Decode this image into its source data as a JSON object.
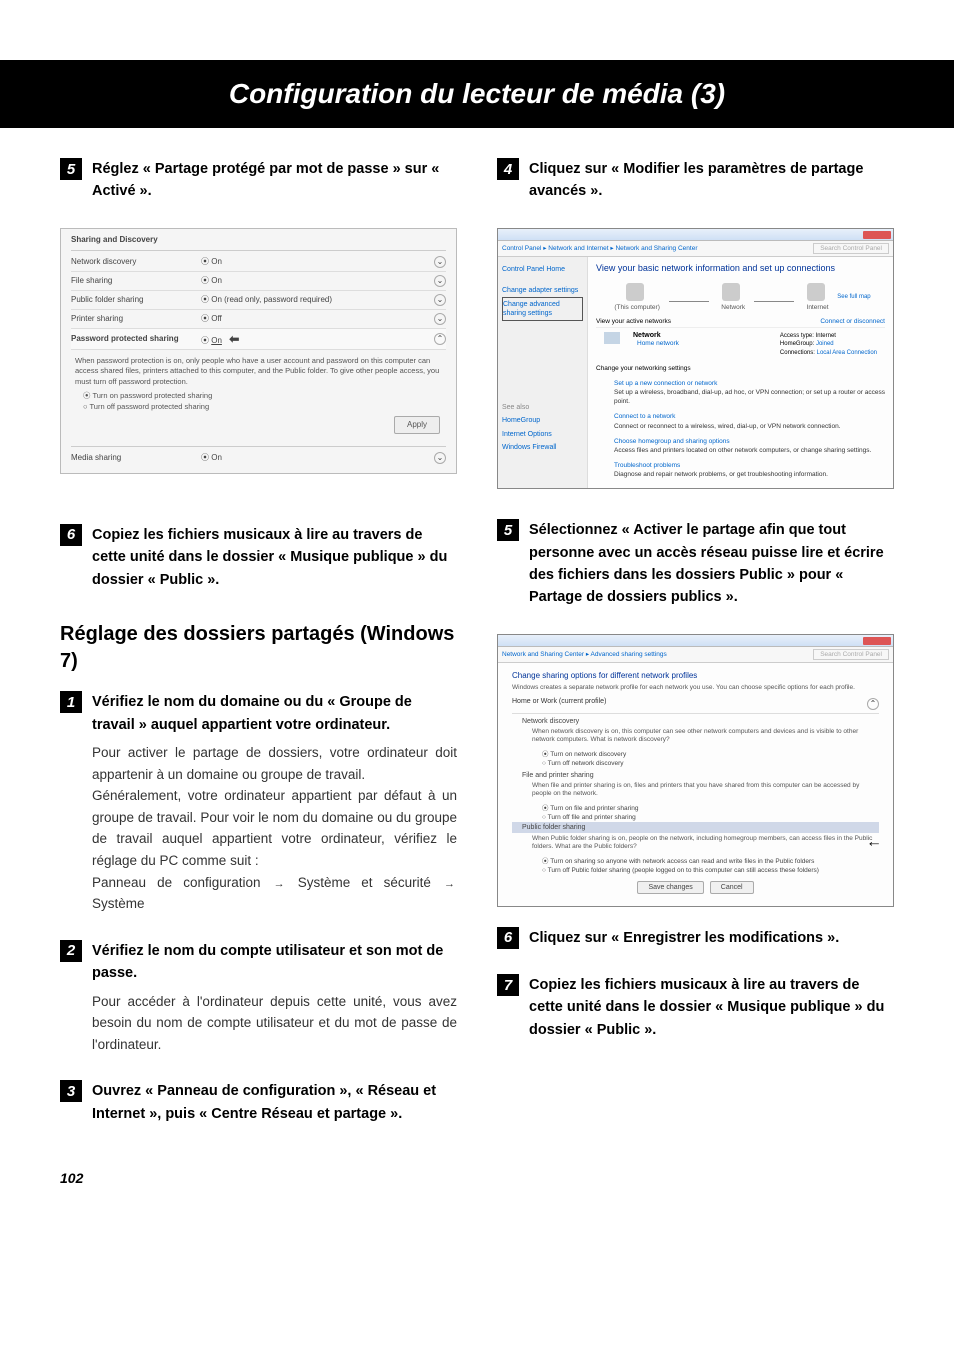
{
  "page_header": "Configuration du lecteur de média (3)",
  "page_number": "102",
  "left": {
    "step5_title": "Réglez « Partage protégé par mot de passe » sur « Activé ».",
    "screenshot1": {
      "panel_title": "Sharing and Discovery",
      "rows": {
        "network_discovery_label": "Network discovery",
        "network_discovery_value": "On",
        "file_sharing_label": "File sharing",
        "file_sharing_value": "On",
        "public_folder_label": "Public folder sharing",
        "public_folder_value": "On (read only, password required)",
        "printer_sharing_label": "Printer sharing",
        "printer_sharing_value": "Off",
        "password_label": "Password protected sharing",
        "password_value": "On",
        "media_sharing_label": "Media sharing",
        "media_sharing_value": "On"
      },
      "explain_text": "When password protection is on, only people who have a user account and password on this computer can access shared files, printers attached to this computer, and the Public folder. To give other people access, you must turn off password protection.",
      "radio1": "Turn on password protected sharing",
      "radio2": "Turn off password protected sharing",
      "apply_btn": "Apply"
    },
    "step6_title": "Copiez les fichiers musicaux à lire au travers de cette unité dans le dossier « Musique publique » du dossier « Public ».",
    "subheading": "Réglage des dossiers partagés (Windows 7)",
    "w7_step1_title": "Vérifiez le nom du domaine ou du « Groupe de travail » auquel appartient votre ordinateur.",
    "w7_step1_body1": "Pour activer le partage de dossiers, votre ordinateur doit appartenir à un domaine ou groupe de travail.",
    "w7_step1_body2a": "Généralement, votre ordinateur appartient par défaut à un groupe de travail. Pour voir le nom du domaine ou du groupe de travail auquel appartient votre ordinateur, vérifiez le réglage du PC comme suit :",
    "w7_step1_body2b": "Panneau de configuration",
    "w7_step1_body2c": "Système et sécurité",
    "w7_step1_body2d": "Système",
    "w7_step2_title": "Vérifiez le nom du compte utilisateur et son mot de passe.",
    "w7_step2_body": "Pour accéder à l'ordinateur depuis cette unité, vous avez besoin du nom de compte utilisateur et du mot de passe de l'ordinateur.",
    "w7_step3_title": "Ouvrez « Panneau de configuration », « Réseau et Internet », puis « Centre Réseau et partage »."
  },
  "right": {
    "step4_title": "Cliquez sur « Modifier les paramètres de partage avancés ».",
    "screenshot2": {
      "breadcrumb": "Control Panel ▸ Network and Internet ▸ Network and Sharing Center",
      "search_placeholder": "Search Control Panel",
      "sidebar": {
        "home": "Control Panel Home",
        "adapter": "Change adapter settings",
        "advanced": "Change advanced sharing settings",
        "seealso": "See also",
        "homegroup": "HomeGroup",
        "inet_options": "Internet Options",
        "firewall": "Windows Firewall"
      },
      "main_title": "View your basic network information and set up connections",
      "see_full_map": "See full map",
      "this_computer": "(This computer)",
      "network_label": "Network",
      "internet_label": "Internet",
      "view_active": "View your active networks",
      "connect_disconnect": "Connect or disconnect",
      "network_name": "Network",
      "home_network": "Home network",
      "access_type_label": "Access type:",
      "access_type_value": "Internet",
      "homegroup_label": "HomeGroup:",
      "homegroup_value": "Joined",
      "connections_label": "Connections:",
      "connections_value": "Local Area Connection",
      "change_networking": "Change your networking settings",
      "opt1_title": "Set up a new connection or network",
      "opt1_desc": "Set up a wireless, broadband, dial-up, ad hoc, or VPN connection; or set up a router or access point.",
      "opt2_title": "Connect to a network",
      "opt2_desc": "Connect or reconnect to a wireless, wired, dial-up, or VPN network connection.",
      "opt3_title": "Choose homegroup and sharing options",
      "opt3_desc": "Access files and printers located on other network computers, or change sharing settings.",
      "opt4_title": "Troubleshoot problems",
      "opt4_desc": "Diagnose and repair network problems, or get troubleshooting information."
    },
    "step5_title": "Sélectionnez « Activer le partage afin que tout personne avec un accès réseau puisse lire et écrire des fichiers dans les dossiers Public » pour « Partage de dossiers publics ».",
    "screenshot3": {
      "breadcrumb": "Network and Sharing Center ▸ Advanced sharing settings",
      "search_placeholder": "Search Control Panel",
      "title": "Change sharing options for different network profiles",
      "subtitle": "Windows creates a separate network profile for each network you use. You can choose specific options for each profile.",
      "profile": "Home or Work (current profile)",
      "nd_label": "Network discovery",
      "nd_desc": "When network discovery is on, this computer can see other network computers and devices and is visible to other network computers. What is network discovery?",
      "nd_on": "Turn on network discovery",
      "nd_off": "Turn off network discovery",
      "fp_label": "File and printer sharing",
      "fp_desc": "When file and printer sharing is on, files and printers that you have shared from this computer can be accessed by people on the network.",
      "fp_on": "Turn on file and printer sharing",
      "fp_off": "Turn off file and printer sharing",
      "pf_label": "Public folder sharing",
      "pf_desc": "When Public folder sharing is on, people on the network, including homegroup members, can access files in the Public folders. What are the Public folders?",
      "pf_on": "Turn on sharing so anyone with network access can read and write files in the Public folders",
      "pf_off": "Turn off Public folder sharing (people logged on to this computer can still access these folders)",
      "save_btn": "Save changes",
      "cancel_btn": "Cancel"
    },
    "step6_title": "Cliquez sur « Enregistrer les modifications ».",
    "step7_title": "Copiez les fichiers musicaux à lire au travers de cette unité dans le dossier « Musique publique » du dossier « Public »."
  }
}
